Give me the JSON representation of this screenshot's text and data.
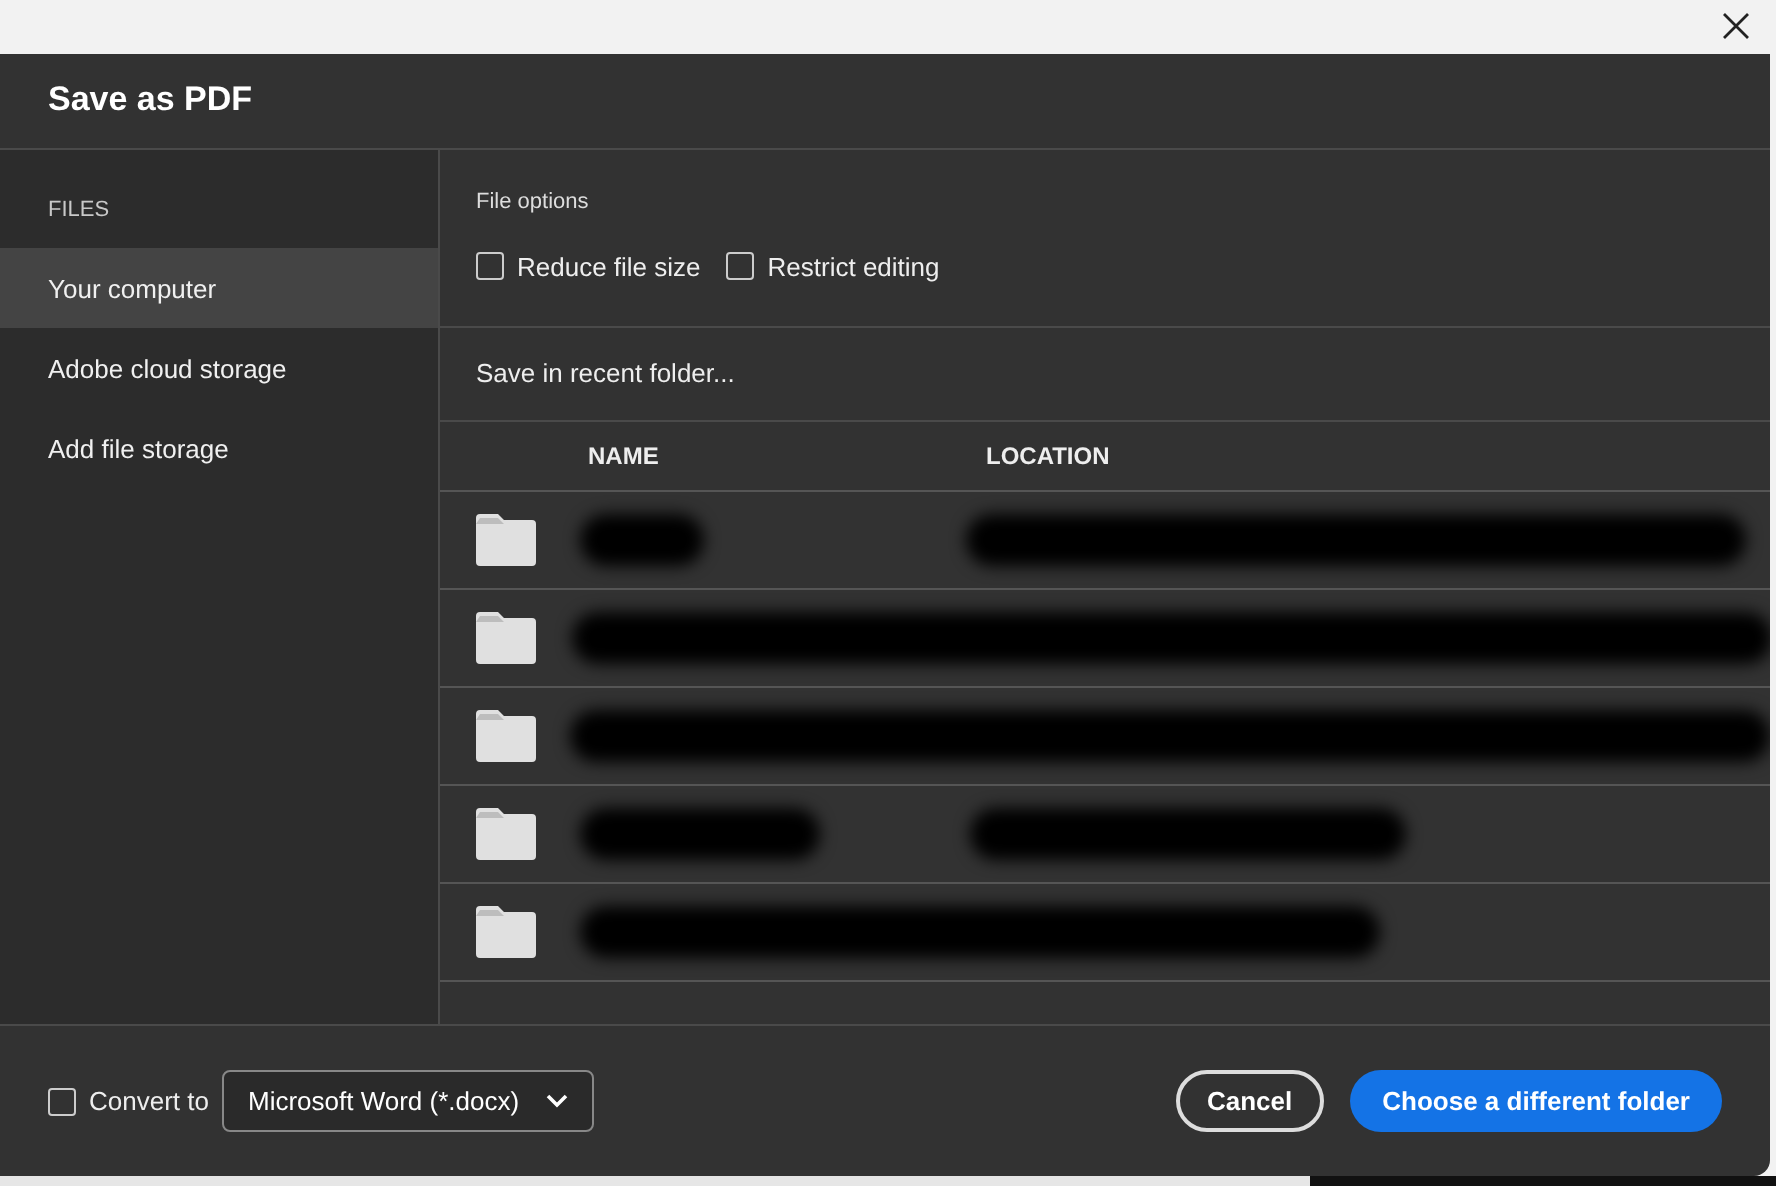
{
  "dialog": {
    "title": "Save as PDF"
  },
  "sidebar": {
    "heading": "FILES",
    "items": [
      {
        "label": "Your computer",
        "selected": true
      },
      {
        "label": "Adobe cloud storage",
        "selected": false
      },
      {
        "label": "Add file storage",
        "selected": false
      }
    ]
  },
  "file_options": {
    "heading": "File options",
    "options": [
      {
        "label": "Reduce file size",
        "checked": false
      },
      {
        "label": "Restrict editing",
        "checked": false
      }
    ]
  },
  "recent": {
    "heading": "Save in recent folder...",
    "columns": [
      "NAME",
      "LOCATION"
    ],
    "rows": [
      {
        "kind": "redacted"
      },
      {
        "kind": "redacted"
      },
      {
        "kind": "redacted"
      },
      {
        "kind": "redacted"
      },
      {
        "kind": "redacted"
      }
    ]
  },
  "footer": {
    "convert": {
      "label": "Convert to",
      "checked": false,
      "format": "Microsoft Word (*.docx)"
    },
    "buttons": [
      {
        "label": "Cancel",
        "kind": "secondary"
      },
      {
        "label": "Choose a different folder",
        "kind": "primary"
      }
    ]
  }
}
